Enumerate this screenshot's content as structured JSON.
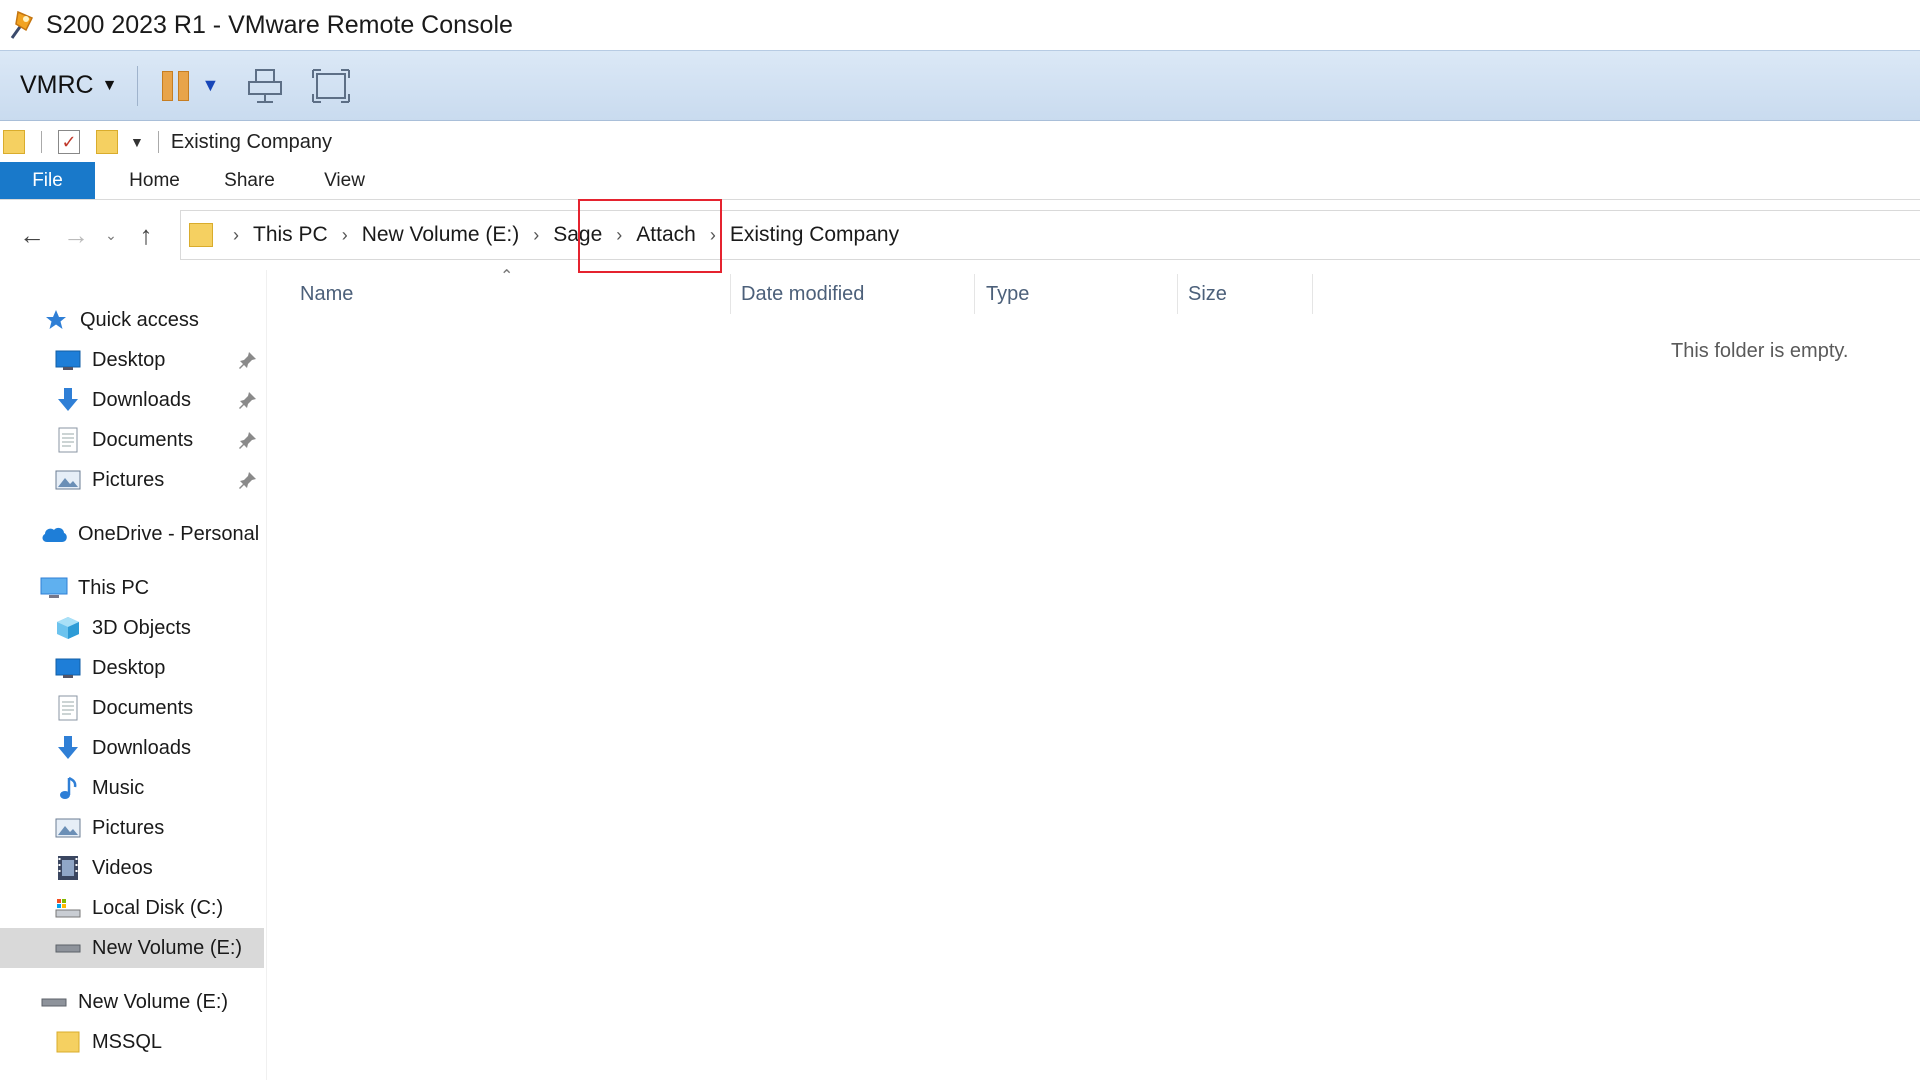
{
  "window": {
    "title": "S200 2023 R1 - VMware Remote Console",
    "icon": "vmware-pin-icon"
  },
  "vmrc_toolbar": {
    "menu_label": "VMRC",
    "icons": [
      "pause-icon",
      "send-ctrl-alt-del-icon",
      "fullscreen-icon"
    ]
  },
  "quick_access_toolbar": {
    "title": "Existing Company"
  },
  "ribbon": {
    "tabs": [
      "File",
      "Home",
      "Share",
      "View"
    ]
  },
  "address_bar": {
    "crumbs": [
      "This PC",
      "New Volume (E:)",
      "Sage",
      "Attach",
      "Existing Company"
    ],
    "highlighted_crumb": "Attach",
    "highlight_color": "#e5232f"
  },
  "nav_pane": {
    "quick_access": {
      "label": "Quick access",
      "items": [
        {
          "label": "Desktop",
          "icon": "desktop-icon",
          "pinned": true
        },
        {
          "label": "Downloads",
          "icon": "download-icon",
          "pinned": true
        },
        {
          "label": "Documents",
          "icon": "documents-icon",
          "pinned": true
        },
        {
          "label": "Pictures",
          "icon": "pictures-icon",
          "pinned": true
        }
      ]
    },
    "onedrive": {
      "label": "OneDrive - Personal"
    },
    "this_pc": {
      "label": "This PC",
      "items": [
        {
          "label": "3D Objects",
          "icon": "3d-objects-icon"
        },
        {
          "label": "Desktop",
          "icon": "desktop-icon"
        },
        {
          "label": "Documents",
          "icon": "documents-icon"
        },
        {
          "label": "Downloads",
          "icon": "download-icon"
        },
        {
          "label": "Music",
          "icon": "music-icon"
        },
        {
          "label": "Pictures",
          "icon": "pictures-icon"
        },
        {
          "label": "Videos",
          "icon": "videos-icon"
        },
        {
          "label": "Local Disk (C:)",
          "icon": "local-disk-icon"
        },
        {
          "label": "New Volume (E:)",
          "icon": "drive-icon",
          "selected": true
        }
      ]
    },
    "drive_root": {
      "label": "New Volume (E:)",
      "items": [
        {
          "label": "MSSQL",
          "icon": "folder-icon"
        }
      ]
    }
  },
  "file_list": {
    "columns": [
      "Name",
      "Date modified",
      "Type",
      "Size"
    ],
    "empty_message": "This folder is empty."
  },
  "colors": {
    "ribbon_file_tab": "#1979ca",
    "selection": "#d9d9d9",
    "toolbar": "#c9dbef"
  }
}
